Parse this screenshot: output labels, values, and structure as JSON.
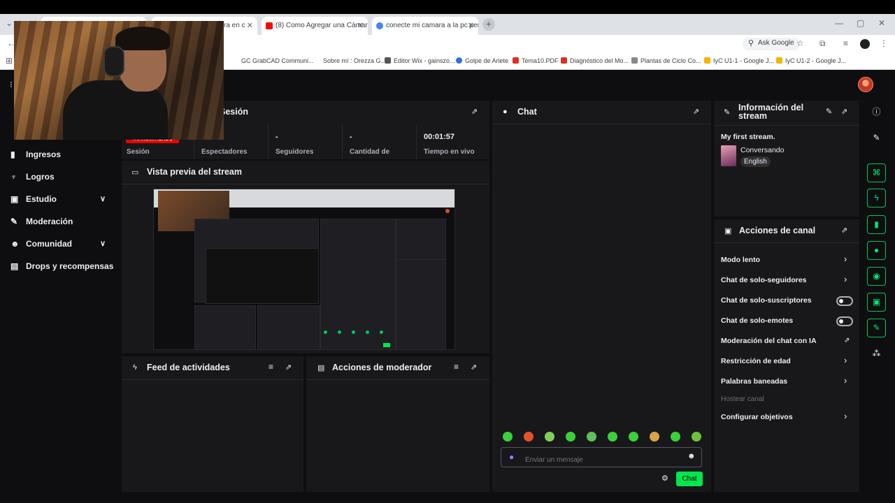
{
  "browser": {
    "tabs": [
      {
        "label": "ra en c",
        "icon": "page-icon"
      },
      {
        "label": "(8) Como Agregar una Cámara",
        "icon": "youtube-icon"
      },
      {
        "label": "conecte mi camara a la pc perc",
        "icon": "google-icon"
      }
    ],
    "ask_google": "Ask Google",
    "bookmarks": [
      "GC GrabCAD Communi...",
      "Sobre mí : Orezza G...",
      "Editor Wix - gainszo...",
      "Golpe de Ariete",
      "Tema10.PDF",
      "Diagnóstico del Mo...",
      "Plantas de Ciclo Co...",
      "IyC U1-1 - Google J...",
      "IyC U1-2 - Google J..."
    ]
  },
  "session": {
    "title": "Sesión",
    "live_badge": "TRANSMITIENDO",
    "stats": [
      {
        "value": "",
        "label": "Sesión"
      },
      {
        "value": "",
        "label": "Espectadores"
      },
      {
        "value": "-",
        "label": "Seguidores"
      },
      {
        "value": "-",
        "label": "Cantidad de"
      },
      {
        "value": "00:01:57",
        "label": "Tiempo en vivo"
      }
    ]
  },
  "nav": {
    "items": [
      {
        "label": "Ingresos",
        "icon": "chart-icon"
      },
      {
        "label": "Logros",
        "icon": "trophy-icon"
      },
      {
        "label": "Estudio",
        "icon": "studio-icon"
      },
      {
        "label": "Moderación",
        "icon": "wrench-icon"
      },
      {
        "label": "Comunidad",
        "icon": "community-icon"
      },
      {
        "label": "Drops y recompensas",
        "icon": "drops-icon"
      }
    ]
  },
  "preview": {
    "title": "Vista previa del stream"
  },
  "feed": {
    "title": "Feed de actividades"
  },
  "mod_actions": {
    "title": "Acciones de moderador"
  },
  "chat": {
    "title": "Chat",
    "placeholder": "Enviar un mensaje",
    "send_label": "Chat",
    "emote_colors": [
      "#3ccf3c",
      "#e2522b",
      "#7fd05c",
      "#3ccf3c",
      "#5fbf5f",
      "#3ccf3c",
      "#3ccf3c",
      "#d9a24a",
      "#3ccf3c",
      "#6fbf3c"
    ]
  },
  "stream_info": {
    "title": "Información del stream",
    "stream_title": "My first stream.",
    "category": "Conversando",
    "language": "English"
  },
  "channel_actions": {
    "title": "Acciones de canal",
    "items": [
      {
        "label": "Modo lento",
        "control": "chevron"
      },
      {
        "label": "Chat de solo-seguidores",
        "control": "chevron"
      },
      {
        "label": "Chat de solo-suscriptores",
        "control": "toggle",
        "on": false
      },
      {
        "label": "Chat de solo-emotes",
        "control": "toggle",
        "on": false
      },
      {
        "label": "Moderación del chat con IA",
        "control": "external"
      },
      {
        "label": "Restricción de edad",
        "control": "chevron"
      },
      {
        "label": "Palabras baneadas",
        "control": "chevron"
      },
      {
        "label": "Hostear canal",
        "control": "none",
        "disabled": true
      },
      {
        "label": "Configurar objetivos",
        "control": "chevron"
      }
    ]
  },
  "colors": {
    "accent": "#00e64d",
    "live": "#eb0400",
    "panel": "#18181b",
    "bg": "#0e0e10"
  }
}
